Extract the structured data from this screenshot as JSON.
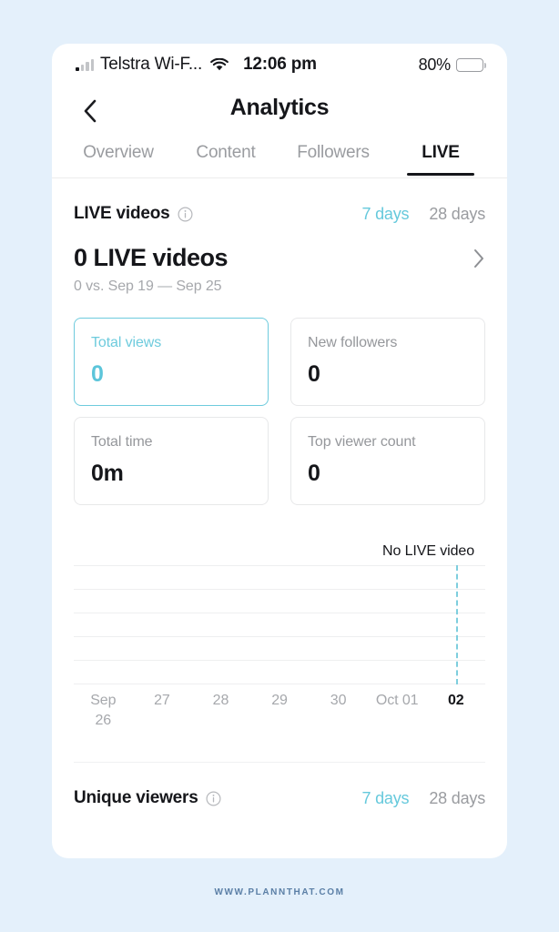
{
  "status_bar": {
    "carrier": "Telstra Wi-F...",
    "time": "12:06 pm",
    "battery_percent": "80%",
    "wifi_icon": "wifi-icon",
    "signal_icon": "cellular-signal-icon",
    "battery_icon": "battery-icon"
  },
  "nav": {
    "back_icon": "chevron-left-icon",
    "title": "Analytics"
  },
  "tabs": [
    {
      "label": "Overview",
      "active": false
    },
    {
      "label": "Content",
      "active": false
    },
    {
      "label": "Followers",
      "active": false
    },
    {
      "label": "LIVE",
      "active": true
    }
  ],
  "live_videos_section": {
    "title": "LIVE videos",
    "info_icon": "info-circle-icon",
    "range_7": "7 days",
    "range_28": "28 days",
    "headline": "0 LIVE videos",
    "chevron_icon": "chevron-right-icon",
    "comparison": "0 vs. Sep 19 — Sep 25",
    "cards": [
      {
        "label": "Total views",
        "value": "0",
        "selected": true
      },
      {
        "label": "New followers",
        "value": "0",
        "selected": false
      },
      {
        "label": "Total time",
        "value": "0m",
        "selected": false
      },
      {
        "label": "Top viewer count",
        "value": "0",
        "selected": false
      }
    ]
  },
  "unique_viewers_section": {
    "title": "Unique viewers",
    "info_icon": "info-circle-icon",
    "range_7": "7 days",
    "range_28": "28 days"
  },
  "footer": {
    "watermark": "WWW.PLANNTHAT.COM"
  },
  "colors": {
    "page_background": "#e4f0fb",
    "accent_teal": "#66c9dc",
    "text_primary": "#15161a",
    "text_muted": "#9a9ca0",
    "card_border": "#e7e8e9",
    "gridline": "#eeeff0"
  },
  "chart_data": {
    "type": "line",
    "title": "",
    "annotation": "No LIVE video",
    "x": [
      "Sep\n26",
      "27",
      "28",
      "29",
      "30",
      "Oct 01",
      "02"
    ],
    "xlabels": [
      "Sep 26",
      "27",
      "28",
      "29",
      "30",
      "Oct 01",
      "02"
    ],
    "values": [
      0,
      0,
      0,
      0,
      0,
      0,
      0
    ],
    "series": [
      {
        "name": "Total views",
        "values": [
          0,
          0,
          0,
          0,
          0,
          0,
          0
        ]
      }
    ],
    "ylim": [
      0,
      5
    ],
    "yticks": [
      0,
      1,
      2,
      3,
      4,
      5
    ],
    "ytick_labels": [
      "",
      "",
      "",
      "",
      "",
      ""
    ],
    "gridlines": 6,
    "grid": true,
    "legend": false,
    "xlabel": "",
    "ylabel": "",
    "marker_line": {
      "x": "02",
      "style": "dashed",
      "color": "#7ecede"
    },
    "highlighted_tick": "02"
  }
}
